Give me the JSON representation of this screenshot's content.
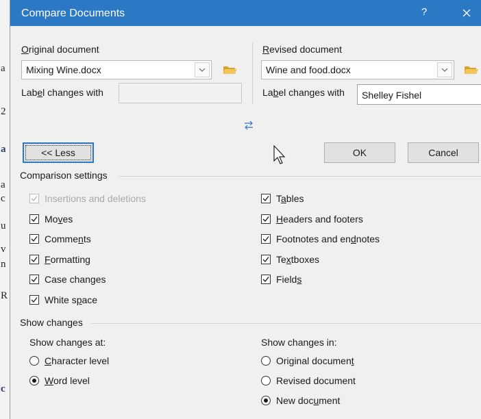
{
  "background_doc": {
    "fragments": [
      "a",
      "2",
      "a",
      "a",
      "c",
      "u",
      "v",
      "n",
      "R",
      "c"
    ]
  },
  "dialog": {
    "title": "Compare Documents",
    "help_label": "?",
    "original": {
      "label_pre": "",
      "label_u": "O",
      "label_post": "riginal document",
      "value": "Mixing Wine.docx",
      "changes_pre": "Lab",
      "changes_u": "e",
      "changes_post": "l changes with",
      "changes_value": ""
    },
    "revised": {
      "label_pre": "",
      "label_u": "R",
      "label_post": "evised document",
      "value": "Wine and food.docx",
      "changes_pre": "La",
      "changes_u": "b",
      "changes_post": "el changes with",
      "changes_value": "Shelley Fishel"
    },
    "less_button": "<< Less",
    "ok_button": "OK",
    "cancel_button": "Cancel",
    "comparison_settings": {
      "heading": "Comparison settings",
      "left": [
        {
          "pre": "Insertions and deletions",
          "u": "",
          "post": "",
          "checked": true,
          "disabled": true
        },
        {
          "pre": "Mo",
          "u": "v",
          "post": "es",
          "checked": true,
          "disabled": false
        },
        {
          "pre": "Comme",
          "u": "n",
          "post": "ts",
          "checked": true,
          "disabled": false
        },
        {
          "pre": "",
          "u": "F",
          "post": "ormatting",
          "checked": true,
          "disabled": false
        },
        {
          "pre": "Case changes",
          "u": "",
          "post": "",
          "checked": true,
          "disabled": false
        },
        {
          "pre": "White s",
          "u": "p",
          "post": "ace",
          "checked": true,
          "disabled": false
        }
      ],
      "right": [
        {
          "pre": "T",
          "u": "a",
          "post": "bles",
          "checked": true,
          "disabled": false
        },
        {
          "pre": "",
          "u": "H",
          "post": "eaders and footers",
          "checked": true,
          "disabled": false
        },
        {
          "pre": "Footnotes and en",
          "u": "d",
          "post": "notes",
          "checked": true,
          "disabled": false
        },
        {
          "pre": "Te",
          "u": "x",
          "post": "tboxes",
          "checked": true,
          "disabled": false
        },
        {
          "pre": "Field",
          "u": "s",
          "post": "",
          "checked": true,
          "disabled": false
        }
      ]
    },
    "show_changes": {
      "heading": "Show changes",
      "at_label": "Show changes at:",
      "at_options": [
        {
          "pre": "",
          "u": "C",
          "post": "haracter level",
          "selected": false
        },
        {
          "pre": "",
          "u": "W",
          "post": "ord level",
          "selected": true
        }
      ],
      "in_label": "Show changes in:",
      "in_options": [
        {
          "pre": "Original documen",
          "u": "t",
          "post": "",
          "selected": false
        },
        {
          "pre": "Revised document",
          "u": "",
          "post": "",
          "selected": false
        },
        {
          "pre": "New doc",
          "u": "u",
          "post": "ment",
          "selected": true
        }
      ]
    }
  },
  "colors": {
    "title_bar": "#2b78c5",
    "dialog_bg": "#f0f0f0",
    "folder": "#e8b53d",
    "swap_icon": "#2b78c5"
  }
}
